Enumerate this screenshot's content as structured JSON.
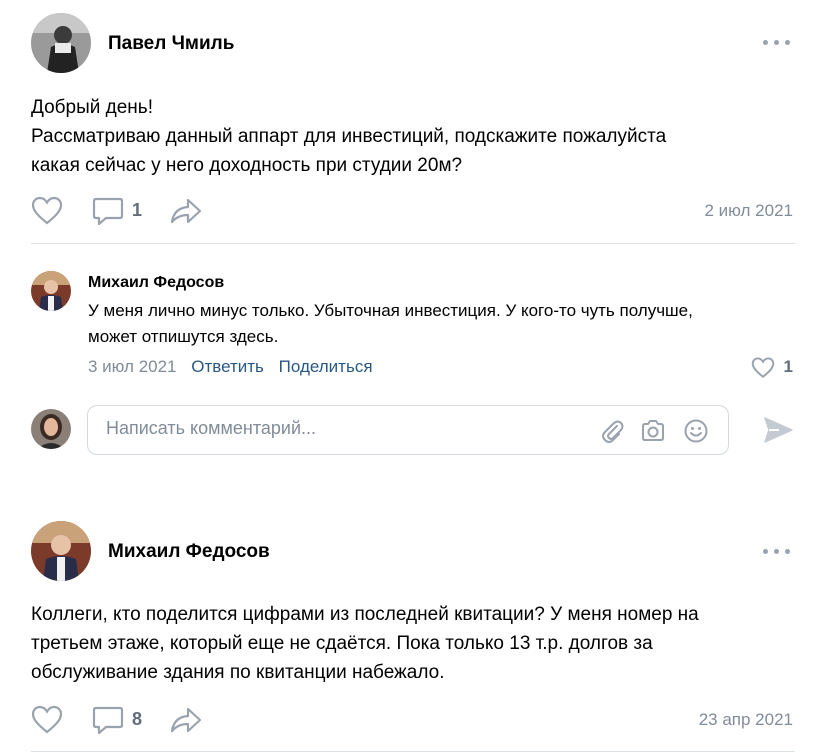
{
  "posts": [
    {
      "author": "Павел Чмиль",
      "text": "Добрый день!\nРассматриваю данный аппарт для инвестиций, подскажите пожалуйста\nкакая сейчас у него доходность при студии 20м?",
      "comments_count": "1",
      "date": "2 июл 2021",
      "avatar_icon": "avatar-photo"
    },
    {
      "author": "Михаил Федосов",
      "text": "Коллеги, кто поделится цифрами из последней квитации? У меня номер на\nтретьем этаже, который еще не сдаётся. Пока только 13 т.р. долгов за\nобслуживание здания по квитанции набежало.",
      "comments_count": "8",
      "date": "23 апр 2021",
      "avatar_icon": "avatar-photo"
    }
  ],
  "comment": {
    "author": "Михаил Федосов",
    "text": "У меня лично минус только. Убыточная инвестиция. У кого-то чуть получше,\nможет отпишутся здесь.",
    "date": "3 июл 2021",
    "reply_label": "Ответить",
    "share_label": "Поделиться",
    "likes": "1"
  },
  "reply": {
    "placeholder": "Написать комментарий..."
  },
  "icons": {
    "like": "heart-icon",
    "comment": "comment-icon",
    "share": "share-icon",
    "attach": "paperclip-icon",
    "camera": "camera-icon",
    "emoji": "emoji-icon",
    "send": "send-icon",
    "more": "more-icon"
  },
  "colors": {
    "link": "#2a5885",
    "icon": "#99a2ad",
    "secondary_text": "#818c99",
    "divider": "#dce1e6"
  }
}
